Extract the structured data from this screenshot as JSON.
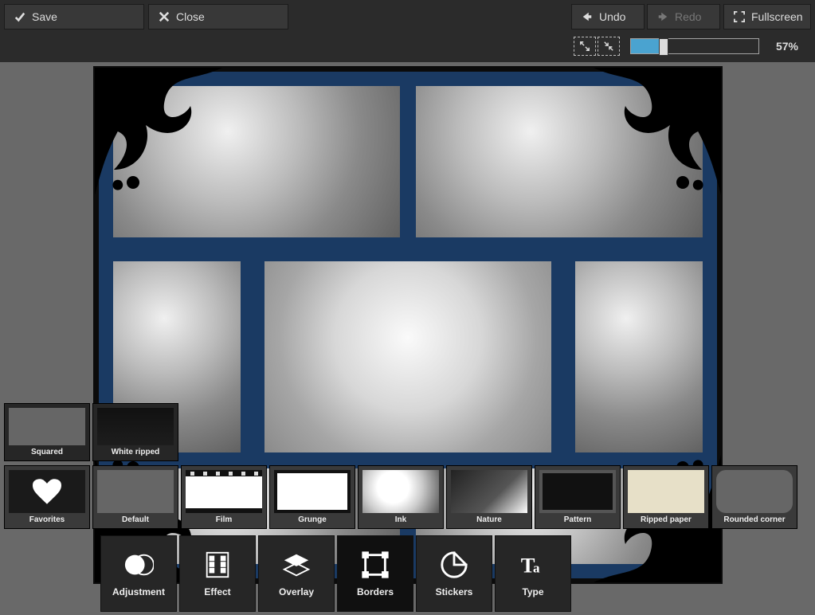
{
  "toolbar": {
    "save": "Save",
    "close": "Close",
    "undo": "Undo",
    "redo": "Redo",
    "fullscreen": "Fullscreen",
    "zoom_percent": "57%",
    "zoom_value": 57
  },
  "paper_thumbs": [
    {
      "label": "Squared"
    },
    {
      "label": "White ripped"
    }
  ],
  "border_thumbs": [
    {
      "label": "Favorites"
    },
    {
      "label": "Default"
    },
    {
      "label": "Film"
    },
    {
      "label": "Grunge"
    },
    {
      "label": "Ink"
    },
    {
      "label": "Nature"
    },
    {
      "label": "Pattern"
    },
    {
      "label": "Ripped paper"
    },
    {
      "label": "Rounded corner"
    }
  ],
  "tools": [
    {
      "label": "Adjustment"
    },
    {
      "label": "Effect"
    },
    {
      "label": "Overlay"
    },
    {
      "label": "Borders",
      "active": true
    },
    {
      "label": "Stickers"
    },
    {
      "label": "Type"
    }
  ]
}
